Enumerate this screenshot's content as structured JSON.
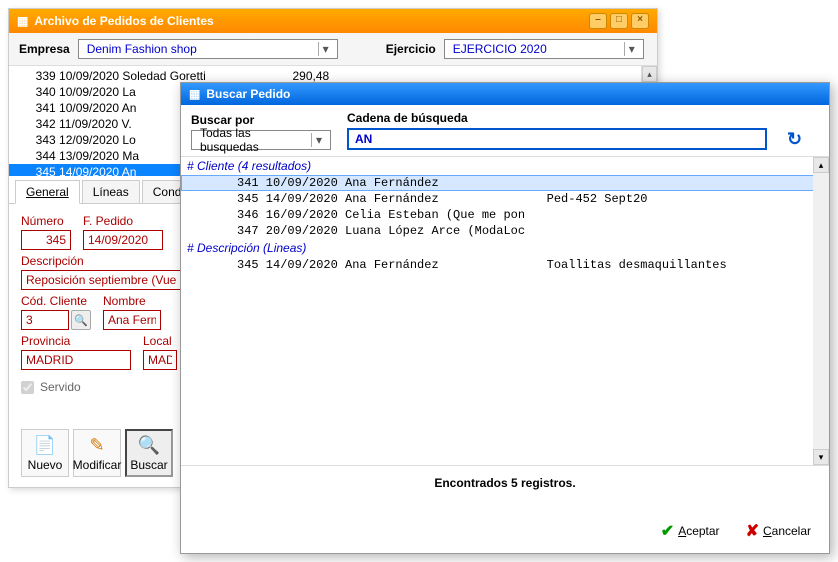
{
  "main_window": {
    "title": "Archivo de Pedidos de Clientes",
    "empresa_label": "Empresa",
    "empresa_value": "Denim Fashion shop",
    "ejercicio_label": "Ejercicio",
    "ejercicio_value": "EJERCICIO 2020",
    "list": [
      "     339 10/09/2020 Soledad Goretti                          290,48",
      "     340 10/09/2020 La",
      "     341 10/09/2020 An",
      "     342 11/09/2020 V.",
      "     343 12/09/2020 Lo",
      "     344 13/09/2020 Ma",
      "     345 14/09/2020 An"
    ],
    "selected_index": 6,
    "tabs": [
      "General",
      "Líneas",
      "Condicion"
    ],
    "active_tab": 0,
    "form": {
      "numero_label": "Número",
      "numero_value": "345",
      "fpedido_label": "F. Pedido",
      "fpedido_value": "14/09/2020",
      "descripcion_label": "Descripción",
      "descripcion_value": "Reposición septiembre (Vuelt",
      "codcliente_label": "Cód. Cliente",
      "codcliente_value": "3",
      "nombre_label": "Nombre",
      "nombre_value": "Ana Ferná",
      "provincia_label": "Provincia",
      "provincia_value": "MADRID",
      "local_label": "Local",
      "local_value": "MAD",
      "servido_label": "Servido"
    },
    "buttons": {
      "nuevo": "Nuevo",
      "modificar": "Modificar",
      "buscar": "Buscar"
    }
  },
  "dialog": {
    "title": "Buscar Pedido",
    "buscar_por_label": "Buscar por",
    "buscar_por_value": "Todas las busquedas",
    "cadena_label": "Cadena de búsqueda",
    "cadena_value": "AN",
    "group_cliente": "# Cliente        (4 resultados)",
    "group_desc": "# Descripción (Lineas)",
    "rows_cliente": [
      "     341 10/09/2020 Ana Fernández",
      "     345 14/09/2020 Ana Fernández               Ped-452 Sept20",
      "     346 16/09/2020 Celia Esteban (Que me pon",
      "     347 20/09/2020 Luana López Arce (ModaLoc"
    ],
    "selected_cliente": 0,
    "rows_desc": [
      "     345 14/09/2020 Ana Fernández               Toallitas desmaquillantes"
    ],
    "status": "Encontrados 5 registros.",
    "aceptar_u": "A",
    "aceptar_rest": "ceptar",
    "cancelar_u": "C",
    "cancelar_rest": "ancelar"
  }
}
